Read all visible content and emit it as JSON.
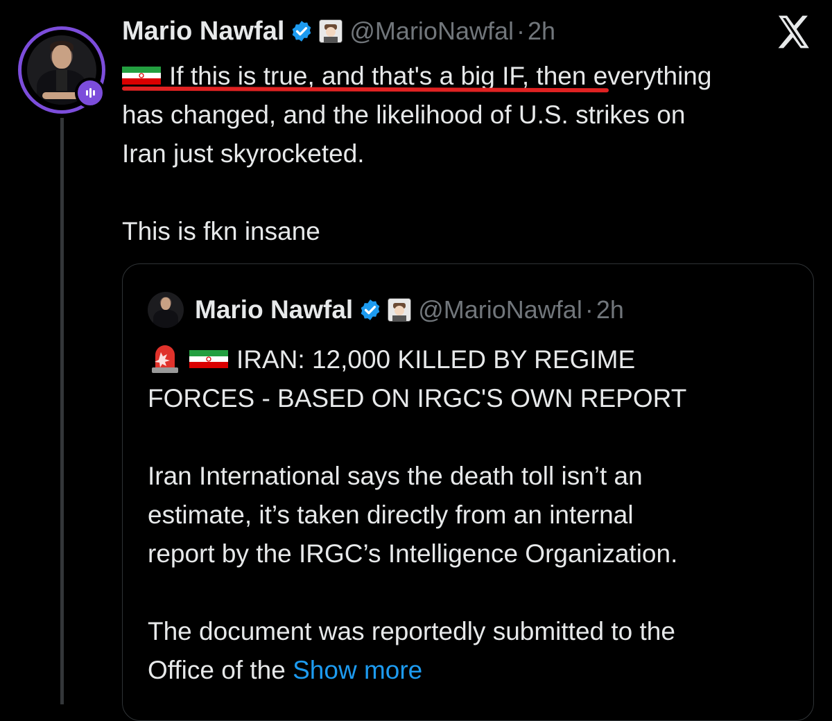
{
  "tweet": {
    "author_name": "Mario Nawfal",
    "handle": "@MarioNawfal",
    "separator": "·",
    "time": "2h",
    "text_line1": "If this is true, and that's a big IF, then everything",
    "text_rest": "has changed, and the likelihood of U.S. strikes on\nIran just skyrocketed.\n\nThis is fkn insane"
  },
  "quote": {
    "author_name": "Mario Nawfal",
    "handle": "@MarioNawfal",
    "separator": "·",
    "time": "2h",
    "headline_line1": "IRAN: 12,000 KILLED BY REGIME",
    "headline_line2": "FORCES - BASED ON IRGC'S OWN REPORT",
    "body": "\nIran International says the death toll isn’t an\nestimate, it’s taken directly from an internal\nreport by the IRGC’s Intelligence Organization.\n\nThe document was reportedly submitted to the\nOffice of the ",
    "show_more": "Show more"
  },
  "icons": {
    "verified": "verified-badge-icon",
    "affiliate": "affiliate-badge-icon",
    "flag": "iran-flag-icon",
    "siren": "siren-icon",
    "x_logo": "x-logo-icon",
    "audio": "audio-space-icon"
  },
  "colors": {
    "background": "#000000",
    "text": "#e7e9ea",
    "muted": "#71767b",
    "link": "#1d9bf0",
    "avatar_ring": "#7c4ddb",
    "annotation": "#e02222"
  }
}
